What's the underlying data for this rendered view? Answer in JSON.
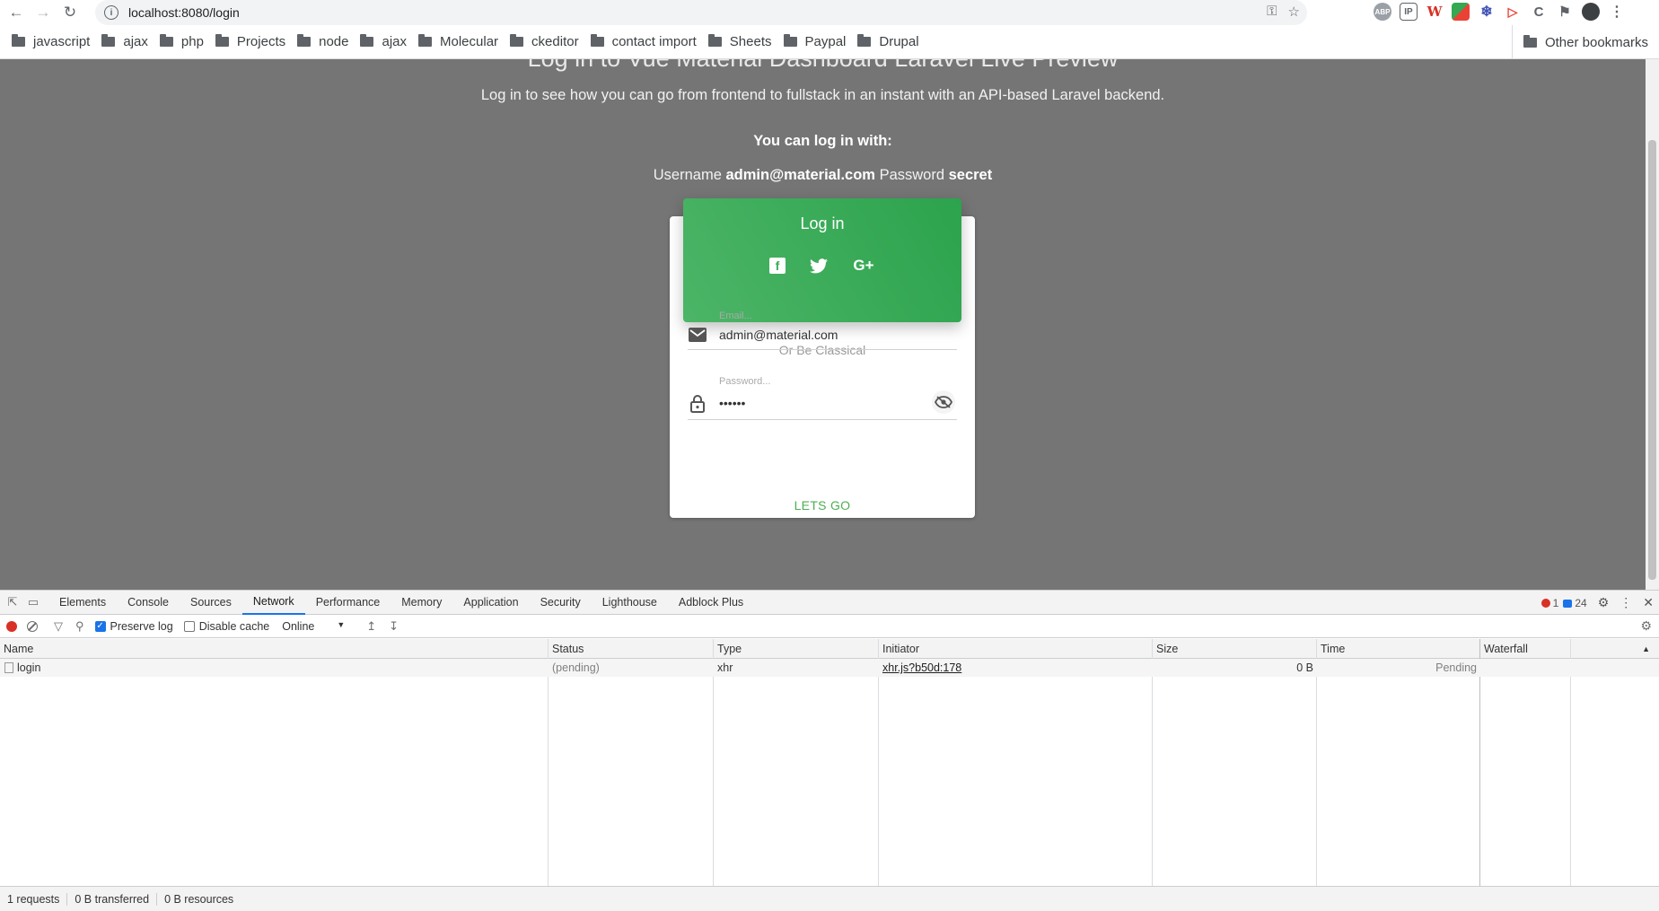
{
  "browser": {
    "url": "localhost:8080/login",
    "bookmarks": [
      "javascript",
      "ajax",
      "php",
      "Projects",
      "node",
      "ajax",
      "Molecular",
      "ckeditor",
      "contact import",
      "Sheets",
      "Paypal",
      "Drupal"
    ],
    "other_bookmarks": "Other bookmarks",
    "extensions": [
      "ABP",
      "IP",
      "W",
      "C"
    ]
  },
  "page": {
    "headline": "Log in to Vue Material Dashboard Laravel Live Preview",
    "subline": "Log in to see how you can go from frontend to fullstack in an instant with an API-based Laravel backend.",
    "login_with": "You can log in with:",
    "creds": {
      "username_label": "Username",
      "username": "admin@material.com",
      "password_label": "Password",
      "password": "secret"
    },
    "card": {
      "title": "Log in",
      "social": {
        "facebook": "f",
        "google": "G+"
      },
      "classical": "Or Be Classical",
      "email_label": "Email...",
      "email_value": "admin@material.com",
      "password_label": "Password...",
      "password_value": "••••••",
      "submit": "LETS GO"
    }
  },
  "devtools": {
    "tabs": [
      "Elements",
      "Console",
      "Sources",
      "Network",
      "Performance",
      "Memory",
      "Application",
      "Security",
      "Lighthouse",
      "Adblock Plus"
    ],
    "active_tab": "Network",
    "errors": "1",
    "messages": "24",
    "preserve_log": "Preserve log",
    "disable_cache": "Disable cache",
    "throttling": "Online",
    "columns": [
      "Name",
      "Status",
      "Type",
      "Initiator",
      "Size",
      "Time",
      "Waterfall"
    ],
    "rows": [
      {
        "name": "login",
        "status": "(pending)",
        "type": "xhr",
        "initiator": "xhr.js?b50d:178",
        "size": "0 B",
        "time": "Pending"
      }
    ],
    "status": {
      "requests": "1 requests",
      "transferred": "0 B transferred",
      "resources": "0 B resources"
    }
  }
}
